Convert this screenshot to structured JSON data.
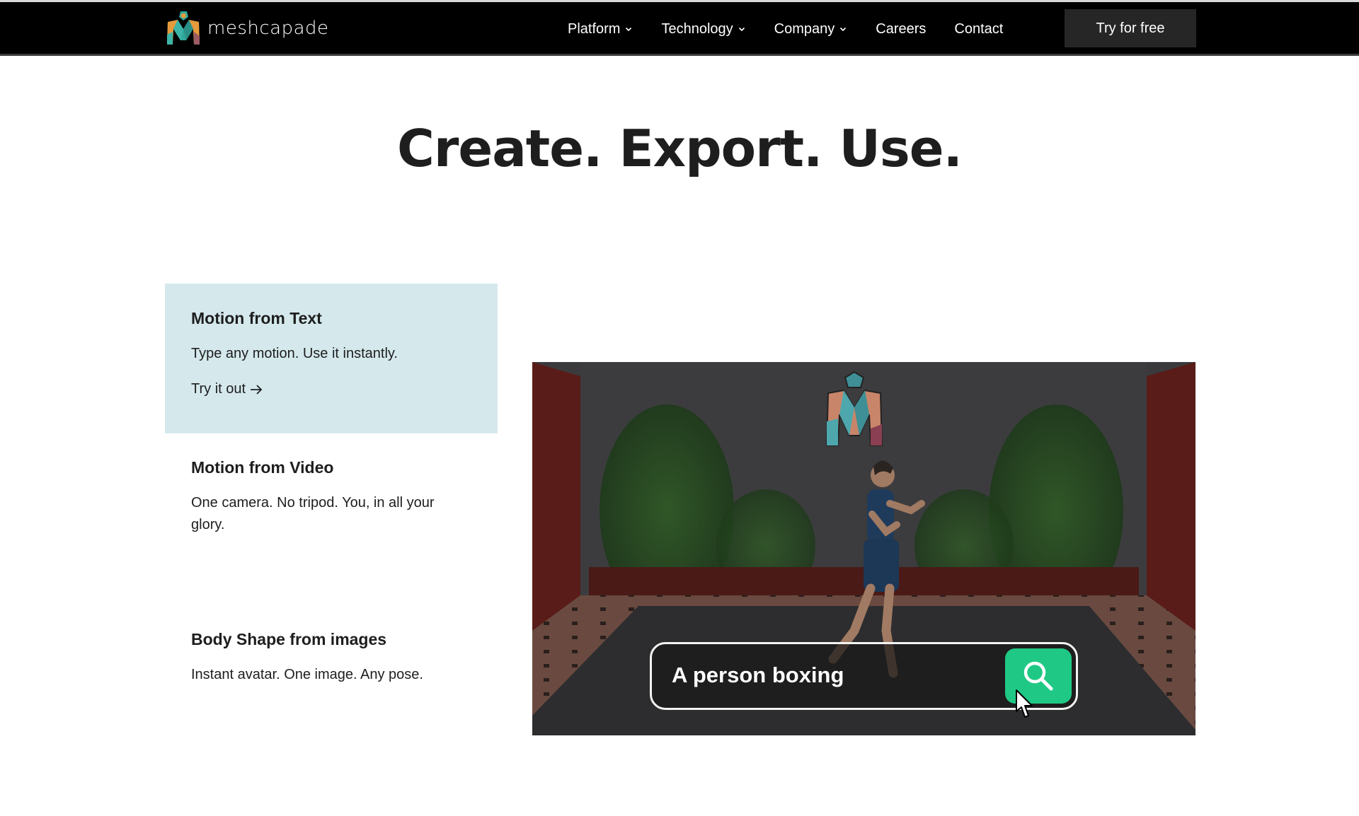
{
  "nav": {
    "brand": "meshcapade",
    "items": [
      {
        "label": "Platform",
        "has_dropdown": true
      },
      {
        "label": "Technology",
        "has_dropdown": true
      },
      {
        "label": "Company",
        "has_dropdown": true
      },
      {
        "label": "Careers",
        "has_dropdown": false
      },
      {
        "label": "Contact",
        "has_dropdown": false
      }
    ],
    "cta_label": "Try for free"
  },
  "hero": {
    "title": "Create. Export. Use."
  },
  "features": [
    {
      "title": "Motion from Text",
      "description": "Type any motion. Use it instantly.",
      "link_label": "Try it out",
      "link_icon": "arrow-right-icon",
      "active": true
    },
    {
      "title": "Motion from Video",
      "description": "One camera. No tripod. You, in all your glory.",
      "active": false
    },
    {
      "title": "Body Shape from images",
      "description": "Instant avatar. One image. Any pose.",
      "active": false
    }
  ],
  "media": {
    "search_query": "A person boxing",
    "search_icon": "search-icon",
    "accent_color": "#1fc985"
  },
  "colors": {
    "nav_bg": "#000000",
    "cta_bg": "#262626",
    "active_card_bg": "#d5e9ed",
    "text": "#1e1e1e"
  }
}
